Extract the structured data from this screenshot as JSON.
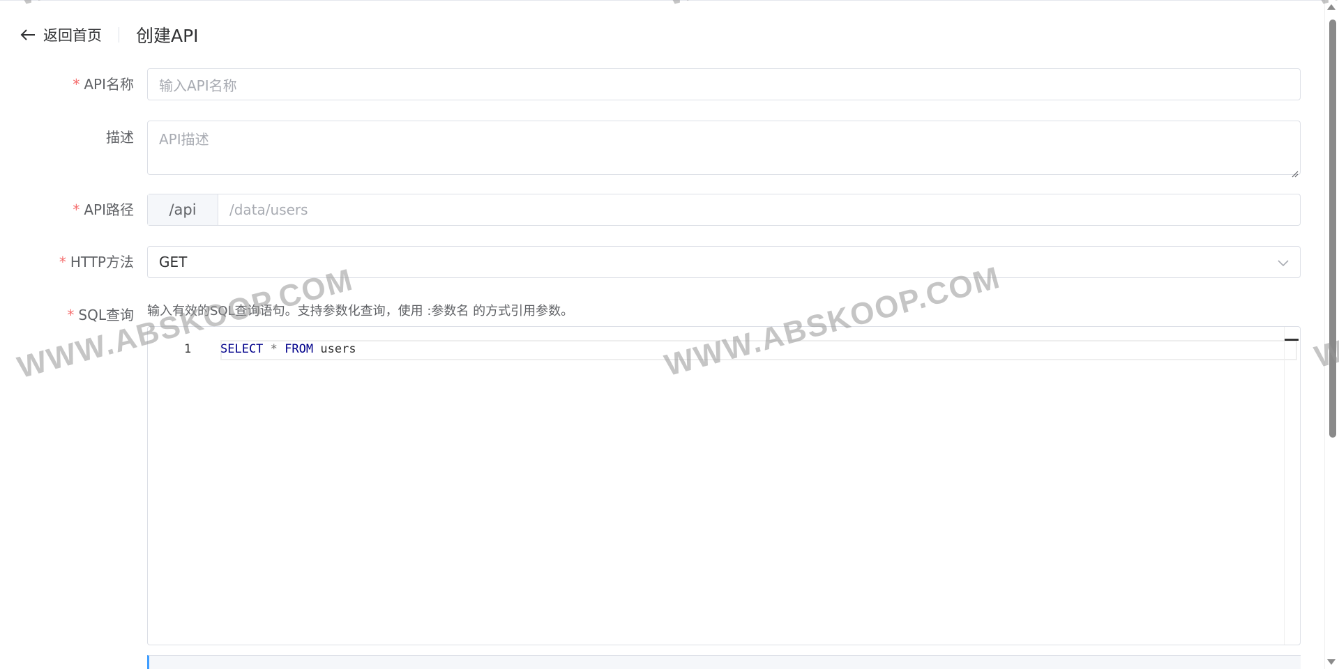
{
  "header": {
    "back_label": "返回首页",
    "title": "创建API"
  },
  "form": {
    "name": {
      "label": "API名称",
      "required": "*",
      "placeholder": "输入API名称"
    },
    "description": {
      "label": "描述",
      "placeholder": "API描述"
    },
    "path": {
      "label": "API路径",
      "required": "*",
      "prefix": "/api",
      "placeholder": "/data/users"
    },
    "method": {
      "label": "HTTP方法",
      "required": "*",
      "value": "GET"
    },
    "sql": {
      "label": "SQL查询",
      "required": "*",
      "hint": "输入有效的SQL查询语句。支持参数化查询，使用 :参数名 的方式引用参数。",
      "line_number": "1",
      "tokens": [
        "SELECT",
        "*",
        "FROM",
        "users"
      ]
    }
  },
  "watermark": "WWW.ABSKOOP.COM",
  "colors": {
    "required": "#f56c6c",
    "keyword": "#00008b",
    "accent": "#409eff"
  }
}
